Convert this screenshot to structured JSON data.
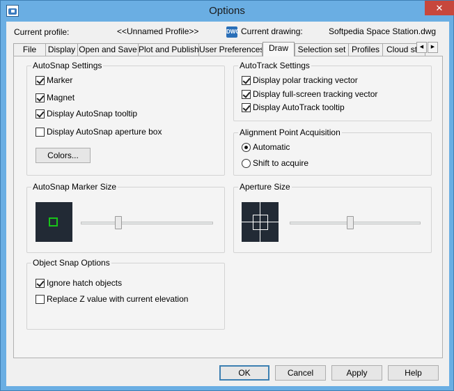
{
  "window": {
    "title": "Options"
  },
  "profile": {
    "current_profile_label": "Current profile:",
    "current_profile_value": "<<Unnamed Profile>>",
    "current_drawing_label": "Current drawing:",
    "current_drawing_value": "Softpedia Space Station.dwg"
  },
  "tabs": [
    {
      "label": "File"
    },
    {
      "label": "Display"
    },
    {
      "label": "Open and Save"
    },
    {
      "label": "Plot and Publish"
    },
    {
      "label": "User Preferences"
    },
    {
      "label": "Draw"
    },
    {
      "label": "Selection set"
    },
    {
      "label": "Profiles"
    },
    {
      "label": "Cloud stora"
    }
  ],
  "active_tab": "Draw",
  "autosnap": {
    "title": "AutoSnap Settings",
    "marker": "Marker",
    "magnet": "Magnet",
    "tooltip": "Display AutoSnap tooltip",
    "aperture_box": "Display AutoSnap aperture box",
    "colors_button": "Colors..."
  },
  "autotrack": {
    "title": "AutoTrack Settings",
    "polar": "Display polar tracking vector",
    "fullscreen": "Display full-screen tracking vector",
    "tooltip": "Display AutoTrack tooltip"
  },
  "alignment": {
    "title": "Alignment Point Acquisition",
    "automatic": "Automatic",
    "shift": "Shift to acquire"
  },
  "marker_size": {
    "title": "AutoSnap Marker Size",
    "slider_value": 0.27
  },
  "aperture_size": {
    "title": "Aperture Size",
    "slider_value": 0.46
  },
  "object_snap": {
    "title": "Object Snap Options",
    "ignore_hatch": "Ignore hatch objects",
    "replace_z": "Replace Z value with current elevation"
  },
  "buttons": {
    "ok": "OK",
    "cancel": "Cancel",
    "apply": "Apply",
    "help": "Help"
  },
  "icons": {
    "app": "autocad-app-icon",
    "drawing": "dwg-file-icon",
    "close": "✕",
    "scroll_left": "◀",
    "scroll_right": "▶"
  },
  "colors": {
    "title_bar": "#6aaee3",
    "close_button": "#c7473c",
    "marker_green": "#18c418",
    "preview_bg": "#222a35"
  }
}
